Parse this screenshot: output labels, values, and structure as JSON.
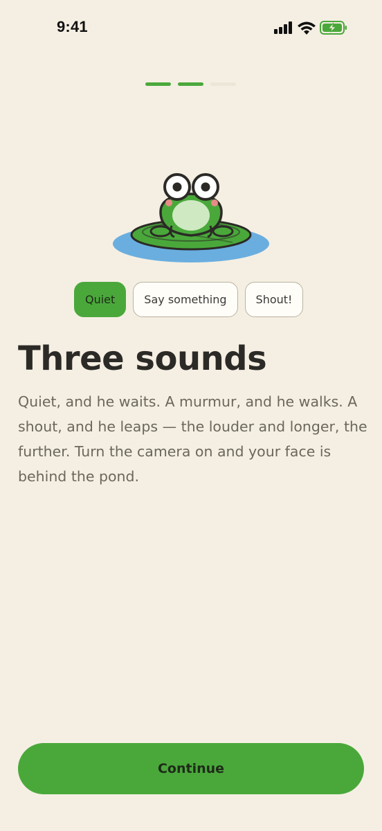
{
  "status_bar": {
    "time": "9:41",
    "icons": [
      "signal-icon",
      "wifi-icon",
      "battery-charging-icon"
    ]
  },
  "progress": {
    "total_steps": 3,
    "current_step": 2
  },
  "illustration": {
    "subject": "frog-on-lily-pad"
  },
  "sound_options": [
    {
      "label": "Quiet",
      "selected": true
    },
    {
      "label": "Say something",
      "selected": false
    },
    {
      "label": "Shout!",
      "selected": false
    }
  ],
  "title": "Three sounds",
  "description": "Quiet, and he waits. A murmur, and he walks. A shout, and he leaps — the louder and longer, the further. Turn the camera on and your face is behind the pond.",
  "continue_label": "Continue",
  "colors": {
    "background": "#f5efe3",
    "accent": "#4aa83b",
    "water": "#6aaee0",
    "text": "#2b2a26",
    "muted_text": "#6b675c"
  }
}
